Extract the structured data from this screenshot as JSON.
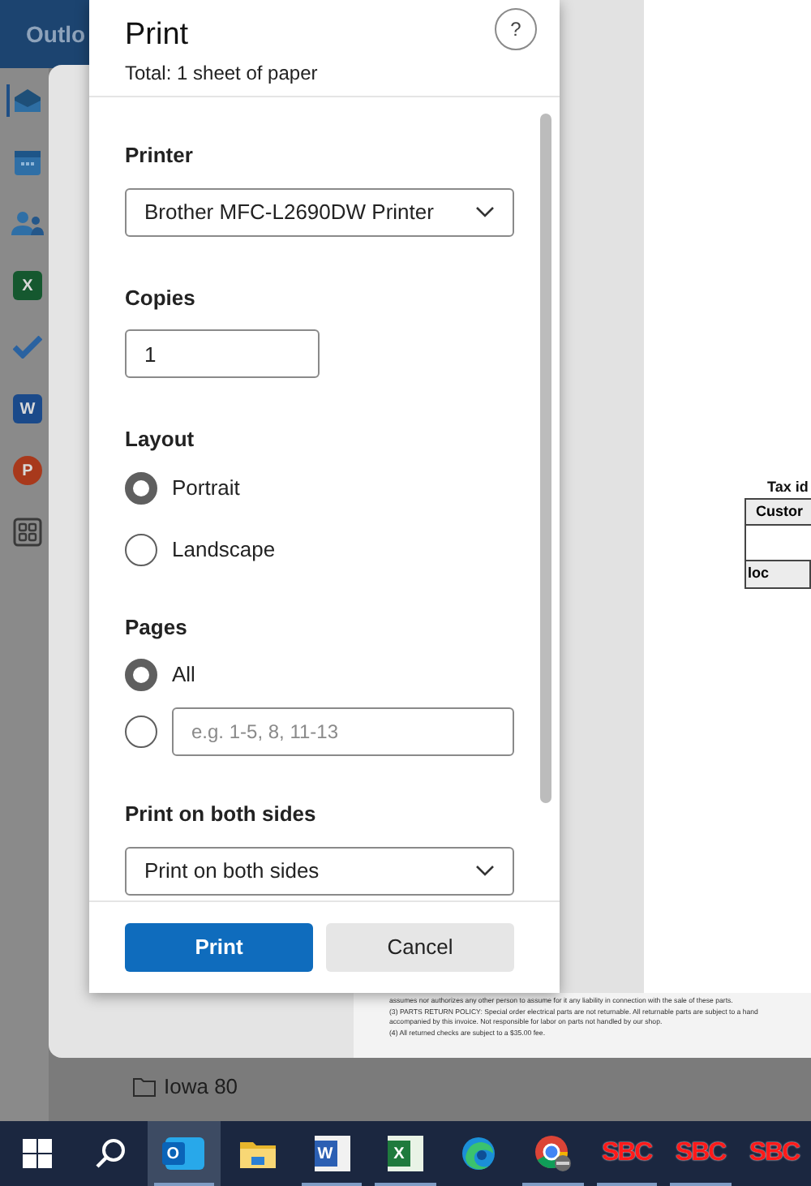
{
  "app": {
    "title": "Outlo"
  },
  "rail": [
    {
      "kind": "mail",
      "selected": true
    },
    {
      "kind": "calendar",
      "selected": false
    },
    {
      "kind": "people",
      "selected": false
    },
    {
      "kind": "excel",
      "glyph": "X",
      "selected": false
    },
    {
      "kind": "todo",
      "selected": false
    },
    {
      "kind": "word",
      "glyph": "W",
      "selected": false
    },
    {
      "kind": "powerpoint",
      "glyph": "P",
      "selected": false
    },
    {
      "kind": "apps",
      "selected": false
    }
  ],
  "folder": {
    "label": "Iowa 80"
  },
  "print_panel": {
    "title": "Print",
    "subtitle": "Total: 1 sheet of paper",
    "help": "?",
    "printer": {
      "label": "Printer",
      "value": "Brother MFC-L2690DW Printer"
    },
    "copies": {
      "label": "Copies",
      "value": "1"
    },
    "layout": {
      "label": "Layout",
      "options": [
        {
          "label": "Portrait",
          "selected": true
        },
        {
          "label": "Landscape",
          "selected": false
        }
      ]
    },
    "pages": {
      "label": "Pages",
      "options": [
        {
          "kind": "label",
          "label": "All",
          "selected": true
        },
        {
          "kind": "field",
          "placeholder": "e.g. 1-5, 8, 11-13",
          "selected": false
        }
      ]
    },
    "duplex": {
      "label": "Print on both sides",
      "value": "Print on both sides"
    },
    "buttons": [
      {
        "kind": "primary",
        "label": "Print"
      },
      {
        "kind": "secondary",
        "label": "Cancel"
      }
    ]
  },
  "preview": {
    "heading": "Tax id",
    "cells": [
      "Custor",
      "loc"
    ],
    "fine_print": [
      "assumes nor authorizes any other person to assume for it any liability in connection with the sale of these parts.",
      "(3) PARTS RETURN POLICY: Special order electrical parts are not returnable. All returnable parts are subject to a hand",
      "accompanied by this invoice. Not responsible for labor on parts not handled by our shop.",
      "(4) All returned checks are subject to a $35.00 fee."
    ]
  },
  "taskbar": [
    {
      "kind": "windows",
      "selected": false,
      "running": false
    },
    {
      "kind": "search",
      "selected": false,
      "running": false
    },
    {
      "kind": "outlook",
      "glyph": "O",
      "selected": true,
      "running": true
    },
    {
      "kind": "explorer",
      "selected": false,
      "running": false
    },
    {
      "kind": "word",
      "glyph": "W",
      "selected": false,
      "running": true
    },
    {
      "kind": "excel",
      "glyph": "X",
      "selected": false,
      "running": true
    },
    {
      "kind": "edge",
      "selected": false,
      "running": false
    },
    {
      "kind": "chrome",
      "selected": false,
      "running": true
    },
    {
      "kind": "sbc",
      "glyph": "SBC",
      "selected": false,
      "running": true
    },
    {
      "kind": "sbc",
      "glyph": "SBC",
      "selected": false,
      "running": true
    },
    {
      "kind": "sbc",
      "glyph": "SBC",
      "selected": false,
      "running": false
    }
  ]
}
